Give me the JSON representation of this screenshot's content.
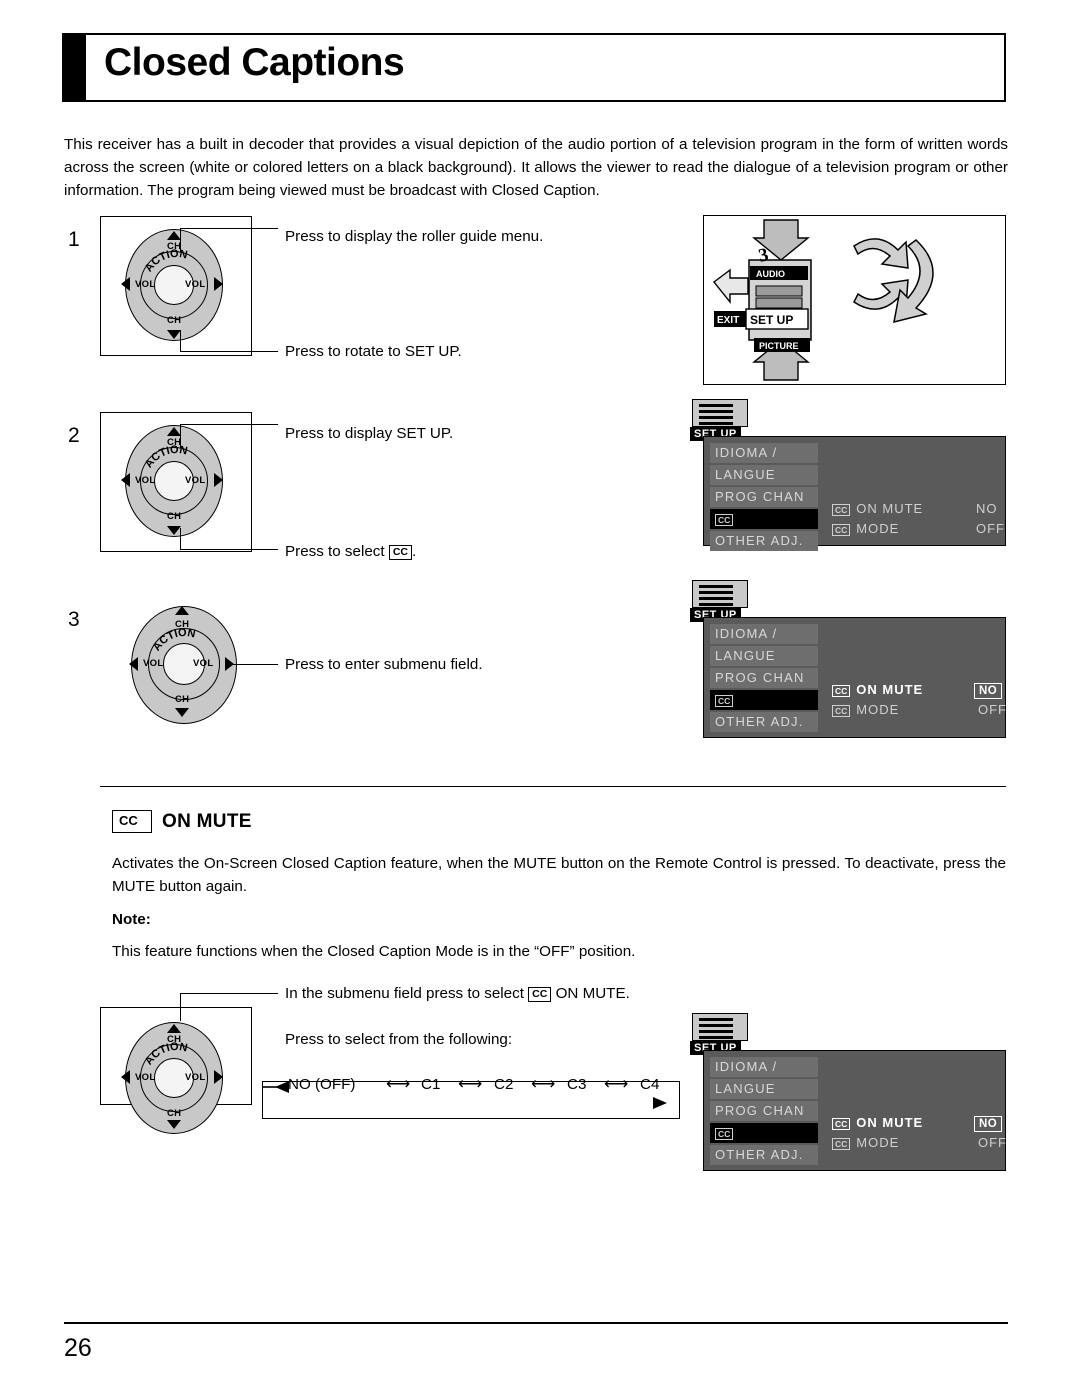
{
  "title": "Closed Captions",
  "intro": "This receiver has a built in decoder that provides a visual depiction of the audio portion of a television program in the form of written words across the screen (white or colored letters on a black background). It allows the viewer to read the dialogue of a television program or other information. The program being viewed must be broadcast with Closed Caption.",
  "steps": [
    {
      "number": "1",
      "line1": "Press to display the roller guide menu.",
      "line2": "Press to rotate to SET UP."
    },
    {
      "number": "2",
      "line1": "Press to display SET UP.",
      "line2_prefix": "Press to select",
      "line2_cc": "CC",
      "line2_suffix": "."
    },
    {
      "number": "3",
      "line1": "Press to enter submenu field."
    }
  ],
  "dial": {
    "action": "ACTION",
    "ch": "CH",
    "vol": "VOL"
  },
  "remote": {
    "audio": "AUDIO",
    "exit": "EXIT",
    "setup": "SET UP",
    "picture": "PICTURE",
    "number": "3"
  },
  "osd": {
    "setup_tab": "SET UP",
    "left_items": [
      "IDIOMA /",
      "LANGUE",
      "PROG  CHAN",
      "CC",
      "OTHER  ADJ."
    ],
    "cc_label": "CC",
    "on_mute": "ON MUTE",
    "mode": "MODE",
    "value_no": "NO",
    "value_off": "OFF"
  },
  "section": {
    "cc_badge": "CC",
    "heading": "ON MUTE",
    "paragraph": "Activates the On-Screen Closed Caption feature, when the MUTE button on the Remote Control is pressed. To deactivate, press the MUTE button again.",
    "note_label": "Note:",
    "note_text": "This feature functions when the Closed Caption Mode is in the “OFF” position."
  },
  "bottom": {
    "line1_prefix": "In the submenu field press to select",
    "line1_cc": "CC",
    "line1_suffix": "ON MUTE.",
    "line2": "Press to select from the following:",
    "cycle": [
      "NO (OFF)",
      "C1",
      "C2",
      "C3",
      "C4"
    ]
  },
  "page_number": "26"
}
